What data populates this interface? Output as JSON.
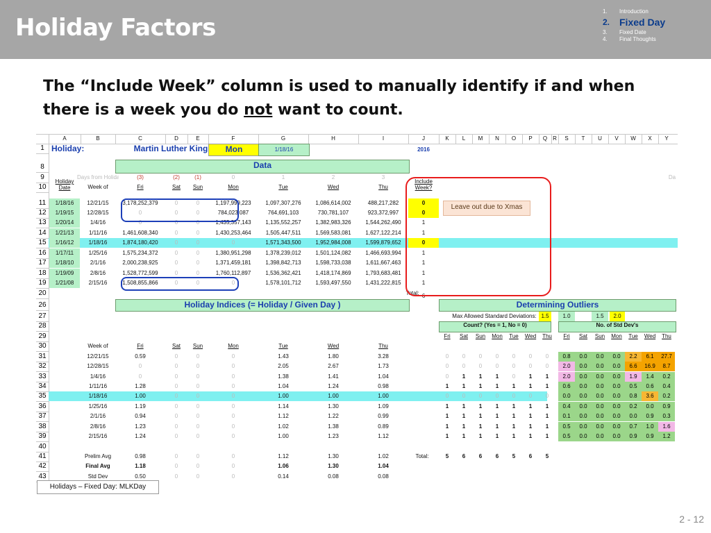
{
  "header": {
    "title": "Holiday Factors",
    "nav": [
      {
        "num": "1.",
        "label": "Introduction",
        "current": false
      },
      {
        "num": "2.",
        "label": "Fixed Day",
        "current": true
      },
      {
        "num": "3.",
        "label": "Fixed Date",
        "current": false
      },
      {
        "num": "4.",
        "label": "Final Thoughts",
        "current": false
      }
    ]
  },
  "subtitle": {
    "pre": "The “Include Week” column is used to manually identify if and when there is a week you do ",
    "emph": "not",
    "post": " want to count."
  },
  "sheet": {
    "col_letters": [
      "A",
      "B",
      "C",
      "D",
      "E",
      "F",
      "G",
      "H",
      "I",
      "J",
      "K",
      "L",
      "M",
      "N",
      "O",
      "P",
      "Q",
      "R",
      "S",
      "T",
      "U",
      "V",
      "W",
      "X",
      "Y"
    ],
    "row1": {
      "label": "Holiday:",
      "holiday": "Martin Luther King D",
      "day": "Mon",
      "date": "1/18/16",
      "year": "2016"
    },
    "data_band": "Data",
    "days_from_holiday_label": "Days from Holiday",
    "days_from_holiday": [
      "(3)",
      "(2)",
      "(1)",
      "0",
      "1",
      "2",
      "3"
    ],
    "da_label": "Da",
    "header_row": [
      "Holiday Date",
      "Week of",
      "Fri",
      "Sat",
      "Sun",
      "Mon",
      "Tue",
      "Wed",
      "Thu",
      "Include Week?"
    ],
    "data_rows": [
      {
        "row": "11",
        "date": "1/18/16",
        "week": "12/21/15",
        "fri": "3,178,252,379",
        "sat": "0",
        "sun": "0",
        "mon": "1,197,999,223",
        "tue": "1,097,307,276",
        "wed": "1,086,614,002",
        "thu": "488,217,282",
        "inc": "0"
      },
      {
        "row": "12",
        "date": "1/19/15",
        "week": "12/28/15",
        "fri": "0",
        "sat": "0",
        "sun": "0",
        "mon": "784,023,087",
        "tue": "764,691,103",
        "wed": "730,781,107",
        "thu": "923,372,997",
        "inc": "0"
      },
      {
        "row": "13",
        "date": "1/20/14",
        "week": "1/4/16",
        "fri": "0",
        "sat": "0",
        "sun": "0",
        "mon": "1,435,357,143",
        "tue": "1,135,552,257",
        "wed": "1,382,983,326",
        "thu": "1,544,262,490",
        "inc": "1"
      },
      {
        "row": "14",
        "date": "1/21/13",
        "week": "1/11/16",
        "fri": "1,461,608,340",
        "sat": "0",
        "sun": "0",
        "mon": "1,430,253,464",
        "tue": "1,505,447,511",
        "wed": "1,569,583,081",
        "thu": "1,627,122,214",
        "inc": "1"
      },
      {
        "row": "15",
        "date": "1/16/12",
        "week": "1/18/16",
        "fri": "1,874,180,420",
        "sat": "0",
        "sun": "0",
        "mon": "0",
        "tue": "1,571,343,500",
        "wed": "1,952,984,008",
        "thu": "1,599,879,652",
        "inc": "0"
      },
      {
        "row": "16",
        "date": "1/17/11",
        "week": "1/25/16",
        "fri": "1,575,234,372",
        "sat": "0",
        "sun": "0",
        "mon": "1,380,951,298",
        "tue": "1,378,239,012",
        "wed": "1,501,124,082",
        "thu": "1,466,693,994",
        "inc": "1"
      },
      {
        "row": "17",
        "date": "1/18/10",
        "week": "2/1/16",
        "fri": "2,000,238,925",
        "sat": "0",
        "sun": "0",
        "mon": "1,371,459,181",
        "tue": "1,398,842,713",
        "wed": "1,598,733,038",
        "thu": "1,611,667,463",
        "inc": "1"
      },
      {
        "row": "18",
        "date": "1/19/09",
        "week": "2/8/16",
        "fri": "1,528,772,599",
        "sat": "0",
        "sun": "0",
        "mon": "1,760,112,897",
        "tue": "1,536,362,421",
        "wed": "1,418,174,869",
        "thu": "1,793,683,481",
        "inc": "1"
      },
      {
        "row": "19",
        "date": "1/21/08",
        "week": "2/15/16",
        "fri": "1,508,855,866",
        "sat": "0",
        "sun": "0",
        "mon": "0",
        "tue": "1,578,101,712",
        "wed": "1,593,497,550",
        "thu": "1,431,222,815",
        "inc": "1"
      }
    ],
    "total_label": "Total:",
    "total_value": "6",
    "note": "Leave out due to Xmas",
    "indices_band": "Holiday Indices  (= Holiday / Given Day )",
    "outliers_band": "Determining Outliers",
    "max_std_label": "Max Allowed Standard Deviations:",
    "max_std_values": [
      "1.5",
      "1.0",
      "1.5",
      "2.0"
    ],
    "count_label": "Count?  (Yes = 1, No = 0)",
    "stddev_label": "No. of Std Dev's",
    "day_heads": [
      "Fri",
      "Sat",
      "Sun",
      "Mon",
      "Tue",
      "Wed",
      "Thu"
    ],
    "index_rows": [
      {
        "row": "31",
        "week": "12/21/15",
        "v": [
          "0.59",
          "0",
          "0",
          "0",
          "1.43",
          "1.80",
          "3.28"
        ],
        "cnt": [
          "0",
          "0",
          "0",
          "0",
          "0",
          "0",
          "0"
        ],
        "sd": [
          "0.8",
          "0.0",
          "0.0",
          "0.0",
          "2.2",
          "6.1",
          "27.7"
        ]
      },
      {
        "row": "32",
        "week": "12/28/15",
        "v": [
          "0",
          "0",
          "0",
          "0",
          "2.05",
          "2.67",
          "1.73"
        ],
        "cnt": [
          "0",
          "0",
          "0",
          "0",
          "0",
          "0",
          "0"
        ],
        "sd": [
          "2.0",
          "0.0",
          "0.0",
          "0.0",
          "6.6",
          "16.9",
          "8.7"
        ]
      },
      {
        "row": "33",
        "week": "1/4/16",
        "v": [
          "0",
          "0",
          "0",
          "0",
          "1.38",
          "1.41",
          "1.04"
        ],
        "cnt": [
          "0",
          "1",
          "1",
          "1",
          "0",
          "1",
          "1"
        ],
        "sd": [
          "2.0",
          "0.0",
          "0.0",
          "0.0",
          "1.9",
          "1.4",
          "0.2"
        ]
      },
      {
        "row": "34",
        "week": "1/11/16",
        "v": [
          "1.28",
          "0",
          "0",
          "0",
          "1.04",
          "1.24",
          "0.98"
        ],
        "cnt": [
          "1",
          "1",
          "1",
          "1",
          "1",
          "1",
          "1"
        ],
        "sd": [
          "0.6",
          "0.0",
          "0.0",
          "0.0",
          "0.5",
          "0.6",
          "0.4"
        ]
      },
      {
        "row": "35",
        "week": "1/18/16",
        "v": [
          "1.00",
          "0",
          "0",
          "0",
          "1.00",
          "1.00",
          "1.00"
        ],
        "cnt": [
          "0",
          "0",
          "0",
          "0",
          "0",
          "0",
          "0"
        ],
        "sd": [
          "0.0",
          "0.0",
          "0.0",
          "0.0",
          "0.8",
          "3.6",
          "0.2"
        ]
      },
      {
        "row": "36",
        "week": "1/25/16",
        "v": [
          "1.19",
          "0",
          "0",
          "0",
          "1.14",
          "1.30",
          "1.09"
        ],
        "cnt": [
          "1",
          "1",
          "1",
          "1",
          "1",
          "1",
          "1"
        ],
        "sd": [
          "0.4",
          "0.0",
          "0.0",
          "0.0",
          "0.2",
          "0.0",
          "0.9"
        ]
      },
      {
        "row": "37",
        "week": "2/1/16",
        "v": [
          "0.94",
          "0",
          "0",
          "0",
          "1.12",
          "1.22",
          "0.99"
        ],
        "cnt": [
          "1",
          "1",
          "1",
          "1",
          "1",
          "1",
          "1"
        ],
        "sd": [
          "0.1",
          "0.0",
          "0.0",
          "0.0",
          "0.0",
          "0.9",
          "0.3"
        ]
      },
      {
        "row": "38",
        "week": "2/8/16",
        "v": [
          "1.23",
          "0",
          "0",
          "0",
          "1.02",
          "1.38",
          "0.89"
        ],
        "cnt": [
          "1",
          "1",
          "1",
          "1",
          "1",
          "1",
          "1"
        ],
        "sd": [
          "0.5",
          "0.0",
          "0.0",
          "0.0",
          "0.7",
          "1.0",
          "1.6"
        ]
      },
      {
        "row": "39",
        "week": "2/15/16",
        "v": [
          "1.24",
          "0",
          "0",
          "0",
          "1.00",
          "1.23",
          "1.12"
        ],
        "cnt": [
          "1",
          "1",
          "1",
          "1",
          "1",
          "1",
          "1"
        ],
        "sd": [
          "0.5",
          "0.0",
          "0.0",
          "0.0",
          "0.9",
          "0.9",
          "1.2"
        ]
      }
    ],
    "prelim": {
      "row": "41",
      "label": "Prelim Avg",
      "v": [
        "0.98",
        "0",
        "0",
        "0",
        "1.12",
        "1.30",
        "1.02"
      ],
      "total_label": "Total:",
      "totals": [
        "5",
        "6",
        "6",
        "6",
        "5",
        "6",
        "5"
      ]
    },
    "final": {
      "row": "42",
      "label": "Final Avg",
      "v": [
        "1.18",
        "0",
        "0",
        "0",
        "1.06",
        "1.30",
        "1.04"
      ]
    },
    "stdev": {
      "row": "43",
      "label": "Std Dev",
      "v": [
        "0.50",
        "0",
        "0",
        "0",
        "0.14",
        "0.08",
        "0.08"
      ]
    },
    "sheet_tab": "Holidays – Fixed Day:  MLKDay"
  },
  "page_number": "2 -  12",
  "colors": {
    "header_bg": "#a6a6a6",
    "band_green": "#b6f0c8",
    "highlight_cyan": "#7ff0f0",
    "callout_red": "#e81c1c",
    "box_blue": "#1c3fb8",
    "nav_current": "#0b3c8c"
  }
}
